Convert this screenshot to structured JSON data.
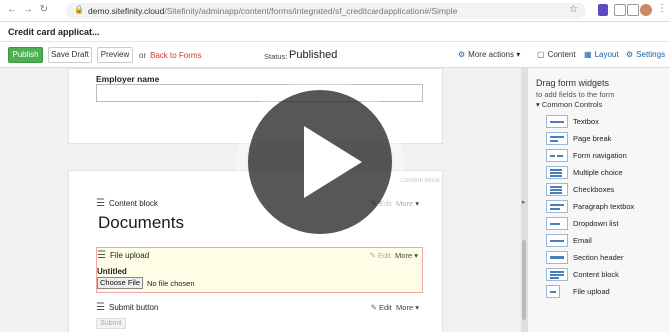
{
  "browser": {
    "url_prefix": "demo.sitefinity.cloud",
    "url_path": "/Sitefinity/adminapp/content/forms/integrated/sf_creditcardapplication#/Simple"
  },
  "app": {
    "title": "Credit card applicat..."
  },
  "toolbar": {
    "publish_label": "Publish",
    "save_draft_label": "Save Draft",
    "preview_label": "Preview",
    "or_text": "or",
    "back_label": "Back to Forms",
    "status_label": "Status:",
    "status_value": "Published",
    "more_actions_label": "More actions"
  },
  "tabs": {
    "content": "Content",
    "layout": "Layout",
    "settings": "Settings"
  },
  "form": {
    "employer_label": "Employer name",
    "content_block": {
      "title": "Content block",
      "edit": "Edit",
      "more": "More",
      "heading": "Documents"
    },
    "file_upload": {
      "title": "File upload",
      "edit": "Edit",
      "more": "More",
      "field_label": "Untitled",
      "choose_label": "Choose File",
      "no_file_text": "No file chosen"
    },
    "submit": {
      "title": "Submit button",
      "edit": "Edit",
      "more": "More",
      "button_label": "Submit"
    },
    "ghost_label": "Content block"
  },
  "panel": {
    "title": "Drag form widgets",
    "subtitle": "to add fields to the form",
    "section": "Common Controls",
    "widgets": [
      {
        "label": "Textbox",
        "icon": "textbox-icon"
      },
      {
        "label": "Page break",
        "icon": "page-break-icon"
      },
      {
        "label": "Form navigation",
        "icon": "form-navigation-icon"
      },
      {
        "label": "Multiple choice",
        "icon": "multiple-choice-icon"
      },
      {
        "label": "Checkboxes",
        "icon": "checkboxes-icon"
      },
      {
        "label": "Paragraph textbox",
        "icon": "paragraph-textbox-icon"
      },
      {
        "label": "Dropdown list",
        "icon": "dropdown-list-icon"
      },
      {
        "label": "Email",
        "icon": "email-icon"
      },
      {
        "label": "Section header",
        "icon": "section-header-icon"
      },
      {
        "label": "Content block",
        "icon": "content-block-icon"
      },
      {
        "label": "File upload",
        "icon": "file-upload-icon"
      }
    ]
  },
  "colors": {
    "publish_green": "#4caf50",
    "link_red": "#d03535",
    "accent_blue": "#1a5ea8"
  }
}
